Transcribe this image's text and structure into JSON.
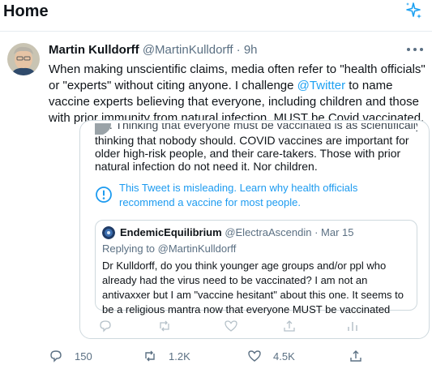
{
  "page": {
    "title": "Home"
  },
  "tweet": {
    "author_name": "Martin Kulldorff",
    "handle": "@MartinKulldorff",
    "separator": "·",
    "time": "9h",
    "text_before": "When making unscientific claims, media often refer to \"health officials\" or \"experts\" without citing anyone. I challenge ",
    "mention": "@Twitter",
    "text_after": " to name vaccine experts believing that everyone, including children and those with prior immunity from natural infection, MUST be Covid vaccinated."
  },
  "quoted": {
    "cut_top": "No. Thinking that everyone must be vaccinated is as scientifically flawed as",
    "text": "thinking that nobody should. COVID vaccines are important for older high-risk people, and their care-takers. Those with prior natural infection do not need it. Nor children.",
    "warning": "This Tweet is misleading. Learn why health officials recommend a vaccine for most people."
  },
  "nested": {
    "name": "EndemicEquilibrium",
    "handle": "@ElectraAscendin",
    "separator": "·",
    "date": "Mar 15",
    "replying": "Replying to @MartinKulldorff",
    "text": "Dr Kulldorff, do you think younger age groups and/or ppl who already had the virus need to be vaccinated? I am not an antivaxxer but I am \"vaccine hesitant\" about this one. It seems to be a religious mantra now that everyone MUST be vaccinated"
  },
  "actions": {
    "replies": "150",
    "retweets": "1.2K",
    "likes": "4.5K"
  },
  "colors": {
    "accent": "#1da1f2",
    "secondary_text": "#5b7083",
    "border": "#cfd9de"
  },
  "icons": [
    "sparkle-icon",
    "more-icon",
    "info-icon",
    "reply-icon",
    "retweet-icon",
    "like-icon",
    "share-icon",
    "analytics-icon"
  ]
}
